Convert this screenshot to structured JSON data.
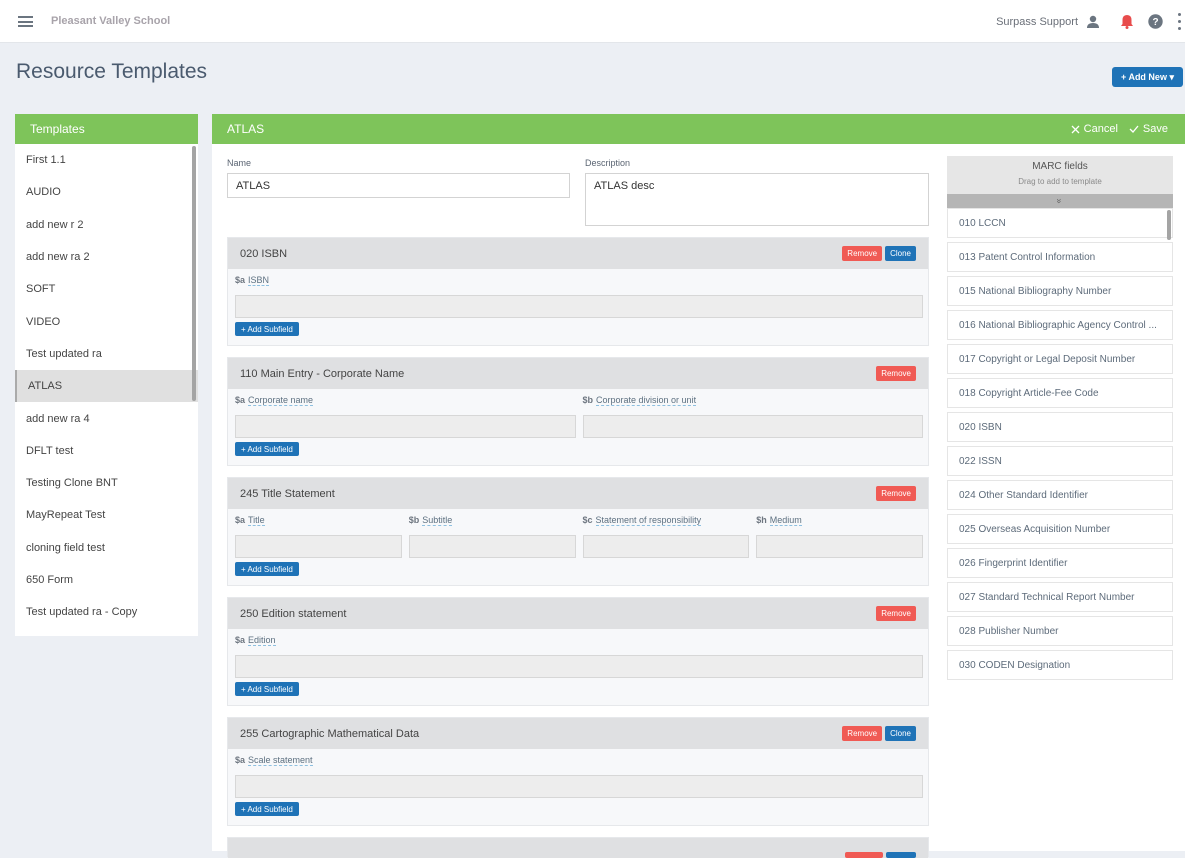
{
  "topbar": {
    "brand": "Pleasant Valley School",
    "user_name": "Surpass Support"
  },
  "page": {
    "title": "Resource Templates",
    "add_new_label": "+ Add New ▾"
  },
  "templates": {
    "header": "Templates",
    "items": [
      {
        "label": "First 1.1"
      },
      {
        "label": "AUDIO"
      },
      {
        "label": "add new r 2"
      },
      {
        "label": "add new ra 2"
      },
      {
        "label": "SOFT"
      },
      {
        "label": "VIDEO"
      },
      {
        "label": "Test updated ra"
      },
      {
        "label": "ATLAS",
        "active": true
      },
      {
        "label": "add new ra 4"
      },
      {
        "label": "DFLT test"
      },
      {
        "label": "Testing Clone BNT"
      },
      {
        "label": "MayRepeat Test"
      },
      {
        "label": "cloning field test"
      },
      {
        "label": "650 Form"
      },
      {
        "label": "Test updated ra - Copy"
      }
    ]
  },
  "editor": {
    "title": "ATLAS",
    "cancel_label": "Cancel",
    "save_label": "Save",
    "name_label": "Name",
    "name_value": "ATLAS",
    "description_label": "Description",
    "description_value": "ATLAS desc",
    "remove_label": "Remove",
    "clone_label": "Clone",
    "add_subfield_label": "+ Add Subfield",
    "fields": [
      {
        "title": "020 ISBN",
        "clone": true,
        "subfields": [
          {
            "code": "$a",
            "name": "ISBN"
          }
        ]
      },
      {
        "title": "110 Main Entry - Corporate Name",
        "clone": false,
        "subfields": [
          {
            "code": "$a",
            "name": "Corporate name"
          },
          {
            "code": "$b",
            "name": "Corporate division or unit"
          }
        ]
      },
      {
        "title": "245 Title Statement",
        "clone": false,
        "subfields": [
          {
            "code": "$a",
            "name": "Title"
          },
          {
            "code": "$b",
            "name": "Subtitle"
          },
          {
            "code": "$c",
            "name": "Statement of responsibility"
          },
          {
            "code": "$h",
            "name": "Medium"
          }
        ]
      },
      {
        "title": "250 Edition statement",
        "clone": false,
        "subfields": [
          {
            "code": "$a",
            "name": "Edition"
          }
        ]
      },
      {
        "title": "255 Cartographic Mathematical Data",
        "clone": true,
        "subfields": [
          {
            "code": "$a",
            "name": "Scale statement"
          }
        ]
      }
    ]
  },
  "marc": {
    "title": "MARC fields",
    "subtitle": "Drag to add to template",
    "expand_icon": "»",
    "items": [
      "010 LCCN",
      "013 Patent Control Information",
      "015 National Bibliography Number",
      "016 National Bibliographic Agency Control ...",
      "017 Copyright or Legal Deposit Number",
      "018 Copyright Article-Fee Code",
      "020 ISBN",
      "022 ISSN",
      "024 Other Standard Identifier",
      "025 Overseas Acquisition Number",
      "026 Fingerprint Identifier",
      "027 Standard Technical Report Number",
      "028 Publisher Number",
      "030 CODEN Designation"
    ]
  },
  "colors": {
    "accent_green": "#7ec45a",
    "primary_blue": "#1f73b7",
    "danger_red": "#f05a54",
    "bell_red": "#e84c4c"
  }
}
